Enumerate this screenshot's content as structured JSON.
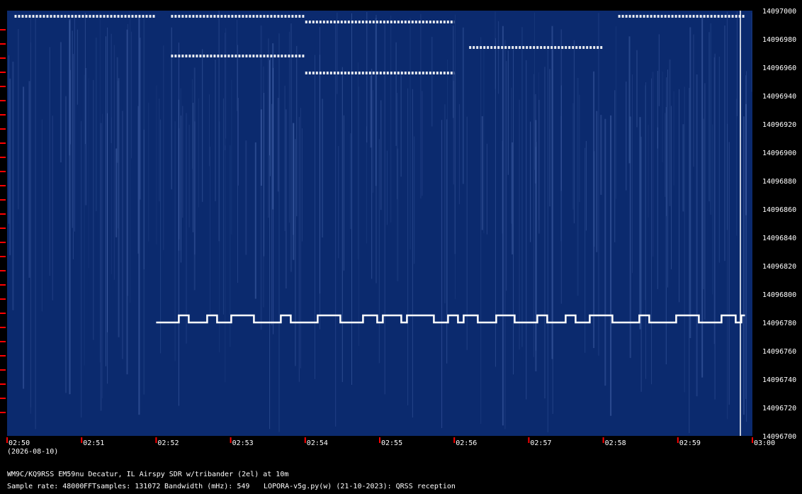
{
  "chart_data": {
    "type": "heatmap",
    "title": "",
    "xlabel": "",
    "ylabel": "",
    "date_label": "(2026-08-10)",
    "x_ticks": [
      "02:50",
      "02:51",
      "02:52",
      "02:53",
      "02:54",
      "02:55",
      "02:56",
      "02:57",
      "02:58",
      "02:59",
      "03:00"
    ],
    "y_ticks": [
      14097000,
      14096980,
      14096960,
      14096940,
      14096920,
      14096900,
      14096880,
      14096860,
      14096840,
      14096820,
      14096800,
      14096780,
      14096760,
      14096740,
      14096720,
      14096700
    ],
    "ylim": [
      14096700,
      14097000
    ],
    "xlim_minutes": [
      0,
      10
    ],
    "colors": {
      "background": "#0b2a6e",
      "signal": "#ffffff",
      "tick": "#ff0000"
    },
    "traces": [
      {
        "name": "",
        "y": 14096780,
        "x_start": 2.0,
        "x_end": 9.9,
        "shift_hz": 5
      },
      {
        "name": "",
        "y": 14096996,
        "x_start": 0.1,
        "x_end": 2.0
      },
      {
        "name": "",
        "y": 14096996,
        "x_start": 2.2,
        "x_end": 4.0
      },
      {
        "name": "",
        "y": 14096996,
        "x_start": 8.2,
        "x_end": 9.9
      },
      {
        "name": "",
        "y": 14096992,
        "x_start": 4.0,
        "x_end": 6.0
      },
      {
        "name": "",
        "y": 14096974,
        "x_start": 6.2,
        "x_end": 8.0
      },
      {
        "name": "",
        "y": 14096968,
        "x_start": 2.2,
        "x_end": 4.0
      },
      {
        "name": "",
        "y": 14096956,
        "x_start": 4.0,
        "x_end": 6.0
      }
    ]
  },
  "footer": {
    "line1": "WM9C/KQ9RSS EM59nu Decatur, IL  Airspy SDR w/tribander (2el) at 10m",
    "sample_rate": "Sample rate: 48000",
    "fft": "FFTsamples: 131072",
    "bandwidth": "Bandwidth (mHz): 549",
    "software": "LOPORA-v5g.py(w) (21-10-2023): QRSS reception"
  }
}
